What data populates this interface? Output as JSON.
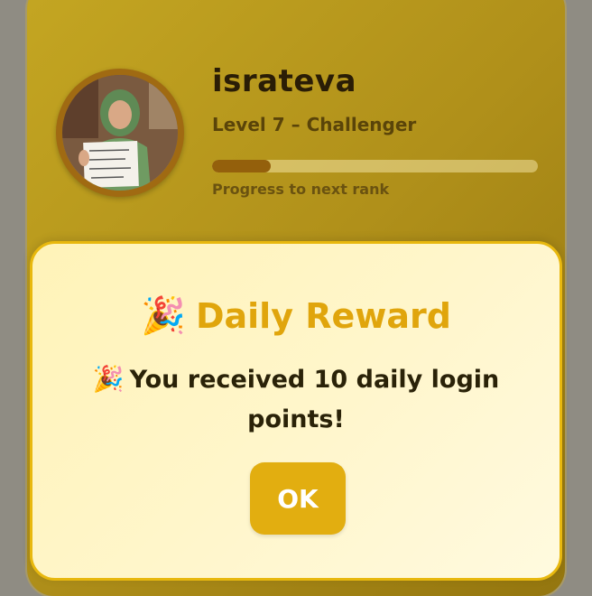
{
  "profile": {
    "username": "israteva",
    "level_text": "Level 7 – Challenger",
    "progress_fraction": 0.18,
    "progress_label": "Progress to next rank",
    "avatar_icon": "user-photo"
  },
  "reward_modal": {
    "title_emoji": "🎉",
    "title": "Daily Reward",
    "message_emoji": "🎉",
    "message": "You received 10 daily login points!",
    "ok_label": "OK"
  },
  "colors": {
    "card_gold": "#b0901a",
    "modal_bg": "#fff6cc",
    "accent": "#e2ae10",
    "progress_fill": "#94600c"
  }
}
